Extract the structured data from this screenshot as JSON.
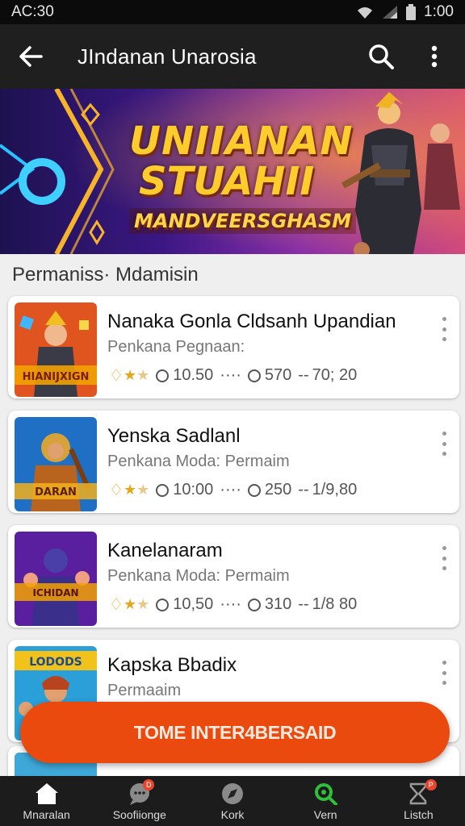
{
  "status_bar": {
    "carrier": "AC:30",
    "time": "1:00"
  },
  "app_bar": {
    "title": "JIndanan Unarosia"
  },
  "banner": {
    "line1": "UNIIANAN",
    "line2": "STUAHII",
    "line3": "MANDVEERSGHASM"
  },
  "section": {
    "title": "Permaniss· Mdamisin"
  },
  "items": [
    {
      "title": "Nanaka Gonla Cldsanh Upandian",
      "subtitle": "Penkana Pegnaan:",
      "rating": 2,
      "stat1": "10.50",
      "stat2": "570",
      "stat3": "70; 20",
      "art": "HIANIJXIGN"
    },
    {
      "title": "Yenska Sadlanl",
      "subtitle": "Penkana Moda: Permaim",
      "rating": 2,
      "stat1": "10:00",
      "stat2": "250",
      "stat3": "1/9,80",
      "art": "DARAN"
    },
    {
      "title": "Kanelanaram",
      "subtitle": "Penkana Moda: Permaim",
      "rating": 2,
      "stat1": "10,50",
      "stat2": "310",
      "stat3": "1/8 80",
      "art": "ICHIDAN"
    },
    {
      "title": "Kapska Bbadix",
      "subtitle": "Permaaim",
      "art": "LODODS"
    }
  ],
  "fab": {
    "label": "TOME INTER4BERSAID"
  },
  "nav": [
    {
      "label": "Mnaralan"
    },
    {
      "label": "Soofiionge",
      "badge": "D"
    },
    {
      "label": "Kork"
    },
    {
      "label": "Vern"
    },
    {
      "label": "Listch",
      "badge": "P"
    }
  ],
  "colors": {
    "accent": "#ea4a0d",
    "nav_active": "#2fbf3a",
    "banner_gold": "#ffcc2e"
  }
}
